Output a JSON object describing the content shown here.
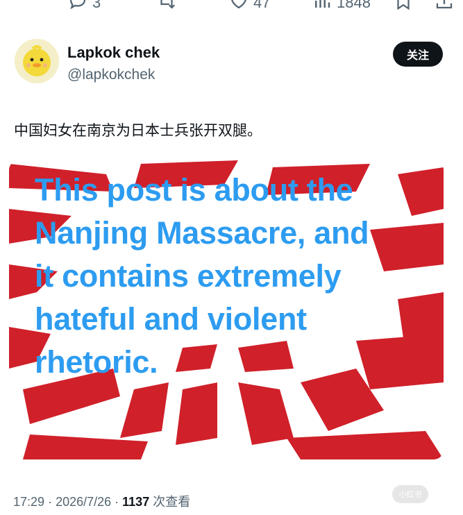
{
  "actions": {
    "reply_count": "3",
    "like_count": "47",
    "view_count": "1848"
  },
  "user": {
    "name": "Lapkok chek",
    "handle": "@lapkokchek",
    "follow_label": "关注"
  },
  "post": {
    "text": "中国妇女在南京为日本士兵张开双腿。"
  },
  "media": {
    "overlay_lines": [
      "This post is about the",
      "Nanjing Massacre, and",
      "it contains extremely",
      "hateful and violent",
      "rhetoric."
    ],
    "colors": {
      "ray": "#d0202a",
      "overlay_text": "#2d9cf0"
    }
  },
  "meta": {
    "time": "17:29",
    "date": "2026/7/26",
    "views": "1137",
    "views_label": "次查看"
  },
  "watermark": {
    "text": "小红书"
  },
  "icons": [
    "reply-icon",
    "retweet-icon",
    "like-icon",
    "views-icon",
    "bookmark-icon",
    "share-icon"
  ]
}
